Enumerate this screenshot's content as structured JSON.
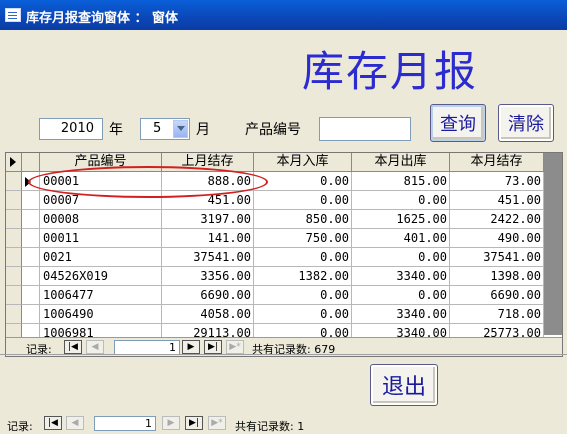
{
  "window": {
    "title": "库存月报查询窗体 ： 窗体"
  },
  "header": {
    "title": "库存月报"
  },
  "filters": {
    "year_value": "2010",
    "year_label": "年",
    "month_value": "5",
    "month_label": "月",
    "product_label": "产品编号",
    "product_value": ""
  },
  "buttons": {
    "query": "查询",
    "clear": "清除",
    "exit": "退出"
  },
  "table": {
    "columns": [
      "产品编号",
      "上月结存",
      "本月入库",
      "本月出库",
      "本月结存"
    ],
    "rows": [
      [
        "00001",
        "888.00",
        "0.00",
        "815.00",
        "73.00"
      ],
      [
        "00007",
        "451.00",
        "0.00",
        "0.00",
        "451.00"
      ],
      [
        "00008",
        "3197.00",
        "850.00",
        "1625.00",
        "2422.00"
      ],
      [
        "00011",
        "141.00",
        "750.00",
        "401.00",
        "490.00"
      ],
      [
        "0021",
        "37541.00",
        "0.00",
        "0.00",
        "37541.00"
      ],
      [
        "04526X019",
        "3356.00",
        "1382.00",
        "3340.00",
        "1398.00"
      ],
      [
        "1006477",
        "6690.00",
        "0.00",
        "0.00",
        "6690.00"
      ],
      [
        "1006490",
        "4058.00",
        "0.00",
        "3340.00",
        "718.00"
      ],
      [
        "1006981",
        "29113.00",
        "0.00",
        "3340.00",
        "25773.00"
      ]
    ]
  },
  "subform_nav": {
    "label": "记录:",
    "current": "1",
    "total_label": "共有记录数: 679"
  },
  "form_nav": {
    "label": "记录:",
    "current": "1",
    "total_label": "共有记录数: 1"
  },
  "colors": {
    "title_blue": "#2b2bd0",
    "highlight_oval": "#d21f1f",
    "titlebar": "#0b47b8"
  }
}
